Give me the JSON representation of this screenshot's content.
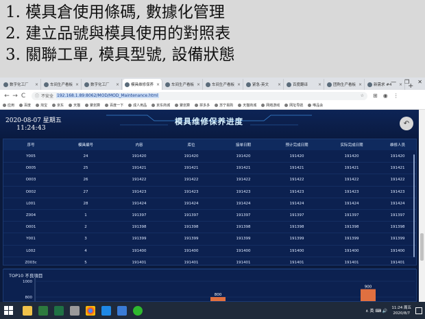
{
  "bullets": [
    "1. 模具倉使用條碼, 數據化管理",
    "2. 建立品號與模具使用的對照表",
    "3. 關聯工單, 模具型號, 設備狀態"
  ],
  "browser": {
    "tabs": [
      {
        "label": "数字化工厂"
      },
      {
        "label": "车间生产看板"
      },
      {
        "label": "数字化工厂"
      },
      {
        "label": "模具维修保养"
      },
      {
        "label": "车间生产看板"
      },
      {
        "label": "车间生产看板"
      },
      {
        "label": "紧急-英文"
      },
      {
        "label": "百度翻译"
      },
      {
        "label": "团购生产看板"
      },
      {
        "label": "新需求 #4"
      }
    ],
    "tab_close": "×",
    "new_tab": "+",
    "window_controls": [
      "—",
      "❐",
      "✕"
    ],
    "nav": {
      "back": "←",
      "forward": "→",
      "reload": "C"
    },
    "insecure_label": "不安全",
    "url": "192.168.1.89:8062/MOD/MOD_Maintenance.html",
    "star": "☆",
    "bookmarks": [
      "应用",
      "百度",
      "淘宝",
      "京东",
      "天猫",
      "聚划算",
      "百度一下",
      "成人用品",
      "京东商城",
      "聚划算",
      "拼多多",
      "苏宁易购",
      "天猫商城",
      "网络游戏",
      "网址导航",
      "唯品会"
    ]
  },
  "dashboard": {
    "date": "2020-08-07  星期五",
    "time": "11:24:43",
    "title": "模具维修保养进度",
    "back_symbol": "↶",
    "columns": [
      "序号",
      "模具编号",
      "内容",
      "库位",
      "接单日期",
      "预计完成日期",
      "实际完成日期",
      "维修人员"
    ],
    "rows": [
      [
        "Y005",
        "24",
        "191420",
        "191420",
        "191420",
        "191420",
        "191420",
        "191420"
      ],
      [
        "O005",
        "25",
        "191421",
        "191421",
        "191421",
        "191421",
        "191421",
        "191421"
      ],
      [
        "O003",
        "26",
        "191422",
        "191422",
        "191422",
        "191422",
        "191422",
        "191422"
      ],
      [
        "O002",
        "27",
        "191423",
        "191423",
        "191423",
        "191423",
        "191423",
        "191423"
      ],
      [
        "L001",
        "28",
        "191424",
        "191424",
        "191424",
        "191424",
        "191424",
        "191424"
      ],
      [
        "Z004",
        "1",
        "191397",
        "191397",
        "191397",
        "191397",
        "191397",
        "191397"
      ],
      [
        "O001",
        "2",
        "191398",
        "191398",
        "191398",
        "191398",
        "191398",
        "191398"
      ],
      [
        "Y001",
        "3",
        "191399",
        "191399",
        "191399",
        "191399",
        "191399",
        "191399"
      ],
      [
        "L002",
        "4",
        "191400",
        "191400",
        "191400",
        "191400",
        "191400",
        "191400"
      ],
      [
        "Z003c",
        "5",
        "191401",
        "191401",
        "191401",
        "191401",
        "191401",
        "191401"
      ]
    ],
    "chart_title": "TOP10 不良項目"
  },
  "chart_data": {
    "type": "bar",
    "title": "TOP10 不良項目",
    "ylim": [
      0,
      1000
    ],
    "yticks": [
      800,
      1000
    ],
    "bar_color": "#e07040",
    "bars": [
      {
        "value": 800,
        "label": "800"
      },
      {
        "value": 900,
        "label": "900"
      }
    ]
  },
  "taskbar": {
    "tray_text": "∧ 英 ⌨ 🔊",
    "clock_time": "11:24 周五",
    "clock_date": "2020/8/7"
  }
}
